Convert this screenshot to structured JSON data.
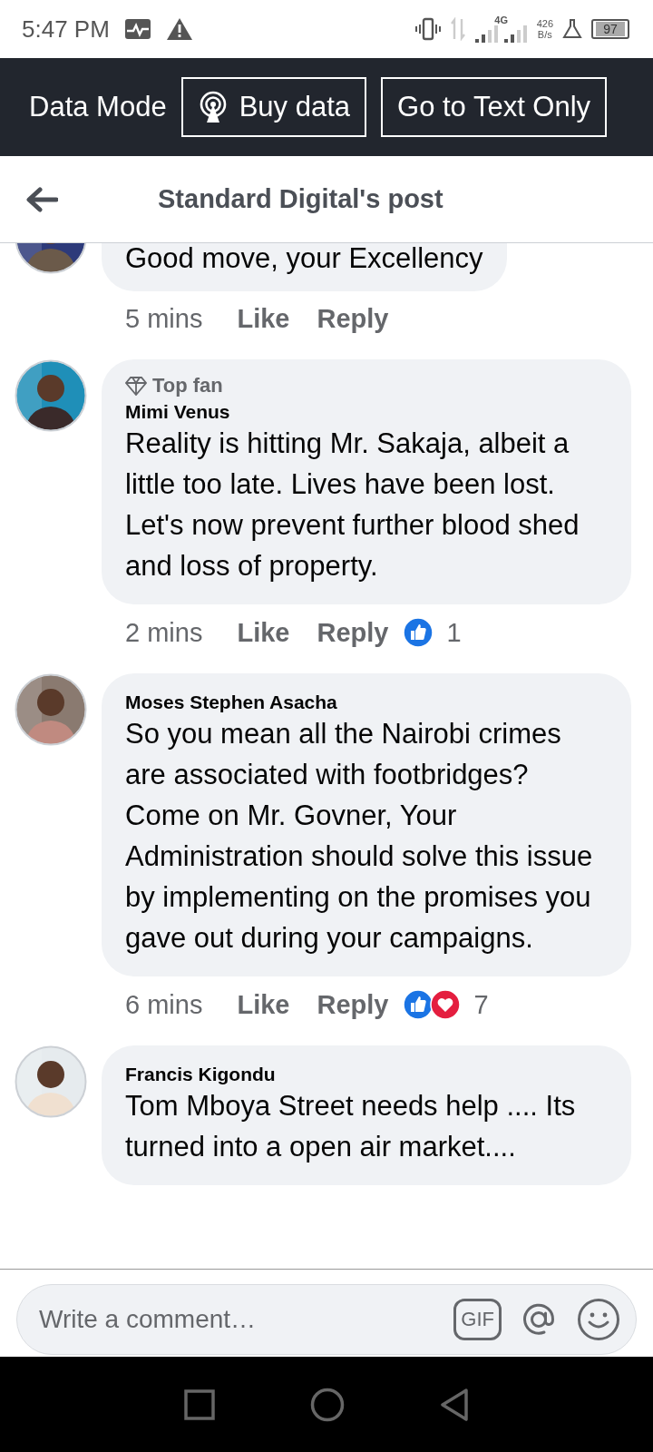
{
  "status_bar": {
    "time": "5:47 PM",
    "network": "4G",
    "speed": "426",
    "speed_unit": "B/s",
    "battery": "97"
  },
  "data_bar": {
    "label": "Data Mode",
    "buttons": [
      {
        "kind": "buy",
        "label": "Buy data"
      },
      {
        "kind": "text",
        "label": "Go to Text Only"
      }
    ]
  },
  "header": {
    "title": "Standard Digital's post"
  },
  "comments": [
    {
      "text": "Good move, your Excellency",
      "time": "5 mins",
      "like": "Like",
      "reply": "Reply"
    },
    {
      "badge": "Top fan",
      "name": "Mimi Venus",
      "text": "Reality is hitting Mr. Sakaja, albeit a little too late. Lives have been lost. Let's now prevent further blood shed and loss of property.",
      "time": "2 mins",
      "like": "Like",
      "reply": "Reply",
      "reactions": [
        {
          "kind": "like"
        }
      ],
      "count": "1"
    },
    {
      "name": "Moses Stephen Asacha",
      "text": "So you mean all the Nairobi crimes are associated with footbridges? Come on Mr. Govner, Your Administration should solve this issue by implementing on the promises you gave out during your campaigns.",
      "time": "6 mins",
      "like": "Like",
      "reply": "Reply",
      "reactions": [
        {
          "kind": "like"
        },
        {
          "kind": "love"
        }
      ],
      "count": "7"
    },
    {
      "name": "Francis Kigondu",
      "text": "Tom Mboya Street needs help .... Its turned into a open air market...."
    }
  ],
  "composer": {
    "placeholder": "Write a comment…",
    "gif": "GIF"
  }
}
